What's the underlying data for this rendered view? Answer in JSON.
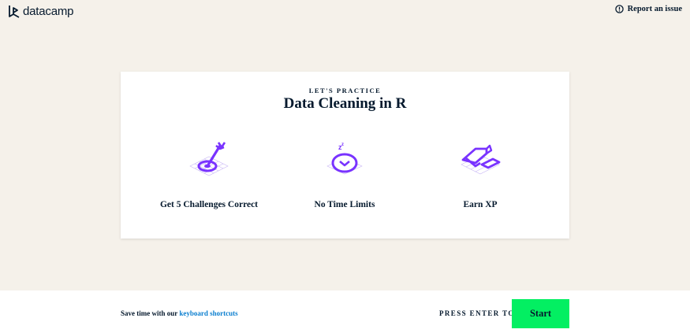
{
  "header": {
    "logo_text": "datacamp",
    "report_label": "Report an issue"
  },
  "card": {
    "eyebrow": "LET'S PRACTICE",
    "title": "Data Cleaning in R",
    "features": [
      {
        "label": "Get 5 Challenges Correct",
        "icon": "target-arrow-icon"
      },
      {
        "label": "No Time Limits",
        "icon": "stopwatch-icon"
      },
      {
        "label": "Earn XP",
        "icon": "trophy-icon"
      }
    ]
  },
  "footer": {
    "tip_prefix": "Save time with our",
    "tip_link": "keyboard shortcuts",
    "press_label": "PRESS ENTER TO",
    "start_label": "Start"
  },
  "colors": {
    "accent_purple": "#7933ff",
    "start_green": "#03ef62",
    "link_blue": "#0a7ecf",
    "text_navy": "#05192d",
    "background": "#f5f1ea"
  }
}
